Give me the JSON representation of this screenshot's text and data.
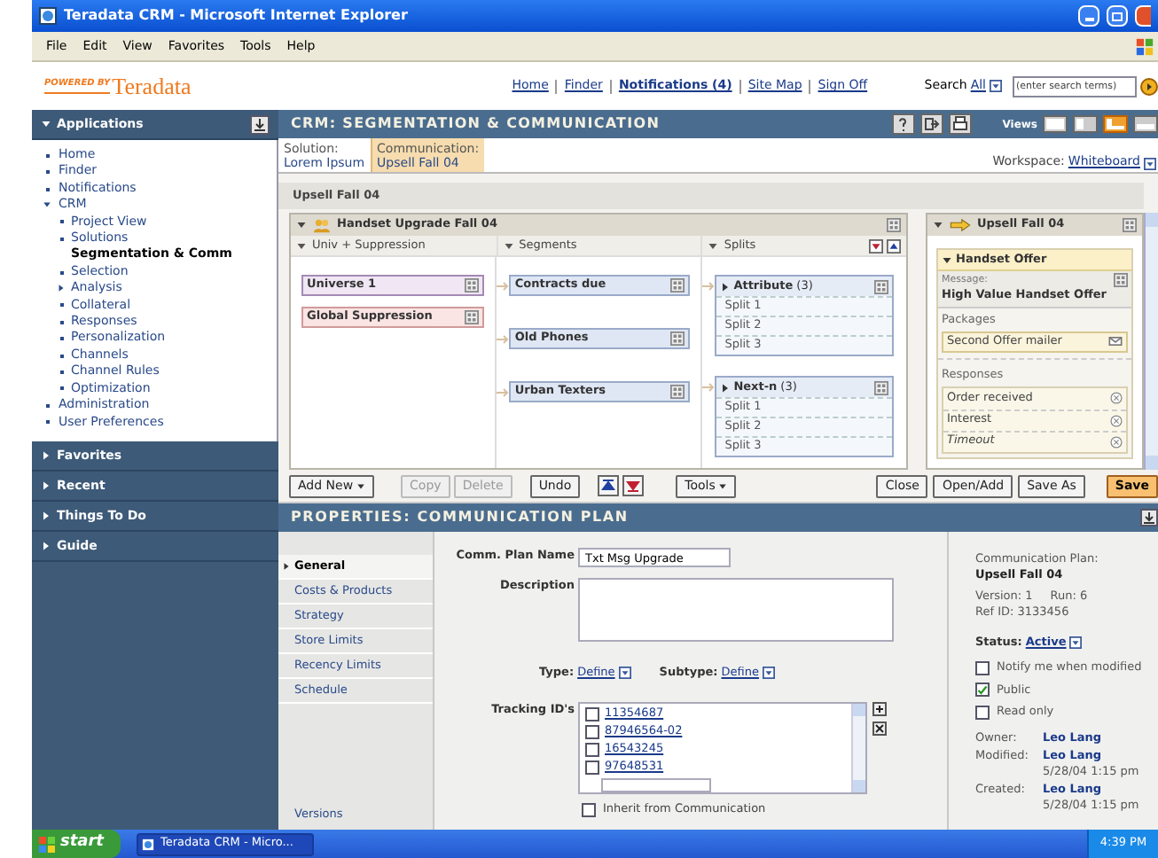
{
  "window": {
    "title": "Teradata CRM - Microsoft Internet Explorer"
  },
  "menu": [
    "File",
    "Edit",
    "View",
    "Favorites",
    "Tools",
    "Help"
  ],
  "header": {
    "logo_top": "POWERED BY",
    "logo": "Teradata",
    "nav": [
      {
        "label": "Home",
        "bold": false
      },
      {
        "label": "Finder",
        "bold": false
      },
      {
        "label": "Notifications (4)",
        "bold": true
      },
      {
        "label": "Site Map",
        "bold": false
      },
      {
        "label": "Sign Off",
        "bold": false
      }
    ],
    "search": {
      "label": "Search",
      "scope": "All",
      "placeholder": "(enter search terms)"
    }
  },
  "sidebar": {
    "sections": [
      {
        "title": "Applications",
        "expanded": true,
        "items": [
          {
            "label": "Home"
          },
          {
            "label": "Finder"
          },
          {
            "label": "Notifications"
          },
          {
            "label": "CRM",
            "expanded": true,
            "children": [
              {
                "label": "Project View",
                "selected": false
              },
              {
                "label": "Solutions",
                "selected": false
              },
              {
                "label": "Segmentation & Comm",
                "selected": true
              },
              {
                "label": "Selection",
                "selected": false
              },
              {
                "label": "Analysis",
                "selected": false,
                "expanded": false
              },
              {
                "label": "Collateral",
                "selected": false
              },
              {
                "label": "Responses",
                "selected": false
              },
              {
                "label": "Personalization",
                "selected": false
              },
              {
                "label": "Channels",
                "selected": false
              },
              {
                "label": "Channel Rules",
                "selected": false
              },
              {
                "label": "Optimization",
                "selected": false
              }
            ]
          },
          {
            "label": "Administration"
          },
          {
            "label": "User Preferences"
          }
        ]
      },
      {
        "title": "Favorites",
        "expanded": false
      },
      {
        "title": "Recent",
        "expanded": false
      },
      {
        "title": "Things To Do",
        "expanded": false
      },
      {
        "title": "Guide",
        "expanded": false
      }
    ]
  },
  "main": {
    "title": "CRM: SEGMENTATION & COMMUNICATION",
    "views_label": "Views",
    "views": [
      {
        "selected": false
      },
      {
        "selected": false
      },
      {
        "selected": true
      },
      {
        "selected": false
      }
    ],
    "breadcrumbs": [
      {
        "label": "Solution:",
        "value": "Lorem Ipsum",
        "selected": false
      },
      {
        "label": "Communication:",
        "value": "Upsell Fall 04",
        "selected": true
      }
    ],
    "workspace": {
      "label": "Workspace:",
      "value": "Whiteboard"
    }
  },
  "canvas": {
    "title": "Upsell Fall 04",
    "plan": {
      "title": "Handset Upgrade Fall 04",
      "columns": [
        "Univ + Suppression",
        "Segments",
        "Splits"
      ],
      "universe": [
        {
          "label": "Universe 1",
          "kind": "universe"
        },
        {
          "label": "Global Suppression",
          "kind": "suppression"
        }
      ],
      "segments": [
        "Contracts due",
        "Old Phones",
        "Urban Texters"
      ],
      "split_groups": [
        {
          "label": "Attribute",
          "count": "(3)",
          "splits": [
            "Split 1",
            "Split 2",
            "Split 3"
          ]
        },
        {
          "label": "Next-n",
          "count": "(3)",
          "splits": [
            "Split 1",
            "Split 2",
            "Split 3"
          ]
        }
      ]
    },
    "communication": {
      "title": "Upsell Fall 04",
      "offer": "Handset Offer",
      "message_label": "Message:",
      "message": "High Value Handset Offer",
      "packages_label": "Packages",
      "packages": [
        "Second Offer mailer"
      ],
      "responses_label": "Responses",
      "responses": [
        {
          "label": "Order received",
          "kind": "response"
        },
        {
          "label": "Interest",
          "kind": "response"
        },
        {
          "label": "Timeout",
          "kind": "timeout"
        }
      ]
    }
  },
  "toolbar": {
    "left": [
      {
        "label": "Add New",
        "kind": "menu",
        "disabled": false
      },
      {
        "label": "Copy",
        "kind": "plain",
        "disabled": true
      },
      {
        "label": "Delete",
        "kind": "plain",
        "disabled": true
      },
      {
        "label": "Undo",
        "kind": "plain",
        "disabled": false
      },
      {
        "label": "Tools",
        "kind": "menu",
        "disabled": false
      }
    ],
    "right": [
      {
        "label": "Close",
        "kind": "plain",
        "disabled": false
      },
      {
        "label": "Open/Add",
        "kind": "plain",
        "disabled": false
      },
      {
        "label": "Save As",
        "kind": "plain",
        "disabled": false
      },
      {
        "label": "Save",
        "kind": "primary",
        "disabled": false
      }
    ]
  },
  "properties": {
    "title": "PROPERTIES: COMMUNICATION PLAN",
    "nav": [
      {
        "label": "General",
        "selected": true
      },
      {
        "label": "Costs & Products",
        "selected": false
      },
      {
        "label": "Strategy",
        "selected": false
      },
      {
        "label": "Store Limits",
        "selected": false
      },
      {
        "label": "Recency Limits",
        "selected": false
      },
      {
        "label": "Schedule",
        "selected": false
      }
    ],
    "nav_footer": "Versions",
    "form": {
      "name_label": "Comm. Plan Name",
      "name_value": "Txt Msg Upgrade",
      "description_label": "Description",
      "type_label": "Type:",
      "type_value": "Define",
      "subtype_label": "Subtype:",
      "subtype_value": "Define",
      "tracking_label": "Tracking ID's",
      "tracking_ids": [
        {
          "label": "11354687",
          "checked": false
        },
        {
          "label": "87946564-02",
          "checked": false
        },
        {
          "label": "16543245",
          "checked": false
        },
        {
          "label": "97648531",
          "checked": false
        }
      ],
      "inherit": {
        "label": "Inherit from Communication",
        "checked": false
      }
    },
    "info": {
      "heading": "Communication Plan:",
      "name": "Upsell Fall 04",
      "version": "Version: 1",
      "run": "Run: 6",
      "ref_id": "Ref ID: 3133456",
      "status_label": "Status:",
      "status": "Active",
      "options": [
        {
          "label": "Notify me when modified",
          "checked": false
        },
        {
          "label": "Public",
          "checked": true
        },
        {
          "label": "Read only",
          "checked": false
        }
      ],
      "people": [
        {
          "label": "Owner:",
          "name": "Leo Lang"
        },
        {
          "label": "Modified:",
          "name": "Leo Lang",
          "date": "5/28/04 1:15 pm"
        },
        {
          "label": "Created:",
          "name": "Leo Lang",
          "date": "5/28/04 1:15 pm"
        }
      ]
    }
  },
  "taskbar": {
    "start": "start",
    "task": "Teradata CRM - Micro...",
    "clock": "4:39 PM"
  }
}
